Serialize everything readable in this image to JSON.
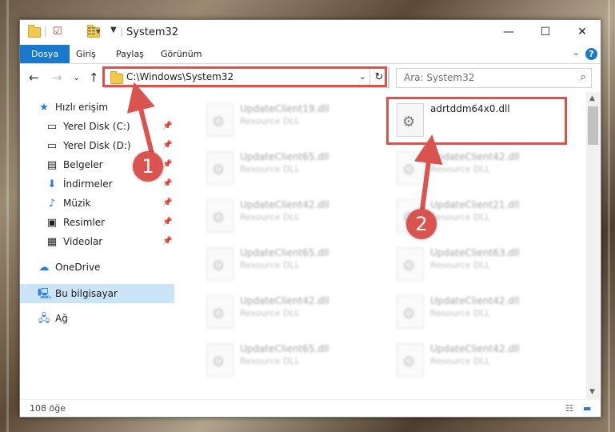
{
  "window": {
    "title": "System32",
    "minimize": "—",
    "maximize": "☐",
    "close": "✕"
  },
  "ribbon": {
    "tabs": [
      "Dosya",
      "Giriş",
      "Paylaş",
      "Görünüm"
    ],
    "help": "?"
  },
  "nav": {
    "back": "←",
    "forward": "→",
    "recent": "⌄",
    "up": "↑",
    "address": "C:\\Windows\\System32",
    "refresh": "↻",
    "search_placeholder": "Ara: System32"
  },
  "sidebar": {
    "items": [
      {
        "label": "Hızlı erişim",
        "icon": "star-icon"
      },
      {
        "label": "Yerel Disk (C:)",
        "icon": "drive-icon",
        "pinned": true
      },
      {
        "label": "Yerel Disk (D:)",
        "icon": "drive-icon",
        "pinned": true
      },
      {
        "label": "Belgeler",
        "icon": "document-icon",
        "pinned": true
      },
      {
        "label": "İndirmeler",
        "icon": "download-icon",
        "pinned": true
      },
      {
        "label": "Müzik",
        "icon": "music-icon",
        "pinned": true
      },
      {
        "label": "Resimler",
        "icon": "pictures-icon",
        "pinned": true
      },
      {
        "label": "Videolar",
        "icon": "video-icon",
        "pinned": true
      },
      {
        "label": "OneDrive",
        "icon": "cloud-icon"
      },
      {
        "label": "Bu bilgisayar",
        "icon": "computer-icon",
        "selected": true
      },
      {
        "label": "Ağ",
        "icon": "network-icon"
      }
    ]
  },
  "files": [
    {
      "name": "UpdateClient19.dll",
      "type": "Resource DLL"
    },
    {
      "name": "adrtddm64x0.dll",
      "type": "",
      "highlighted": true
    },
    {
      "name": "UpdateClient65.dll",
      "type": "Resource DLL"
    },
    {
      "name": "UpdateClient42.dll",
      "type": "Resource DLL"
    },
    {
      "name": "UpdateClient42.dll",
      "type": "Resource DLL"
    },
    {
      "name": "UpdateClient21.dll",
      "type": "Resource DLL"
    },
    {
      "name": "UpdateClient65.dll",
      "type": "Resource DLL"
    },
    {
      "name": "UpdateClient63.dll",
      "type": "Resource DLL"
    },
    {
      "name": "UpdateClient42.dll",
      "type": "Resource DLL"
    },
    {
      "name": "UpdateClient42.dll",
      "type": "Resource DLL"
    },
    {
      "name": "UpdateClient65.dll",
      "type": "Resource DLL"
    },
    {
      "name": "UpdateClient42.dll",
      "type": "Resource DLL"
    }
  ],
  "status": {
    "count": "108 öğe"
  },
  "callouts": [
    "1",
    "2"
  ],
  "colors": {
    "accent": "#1979ca",
    "highlight": "#d9534f",
    "selection": "#cce4f7"
  }
}
